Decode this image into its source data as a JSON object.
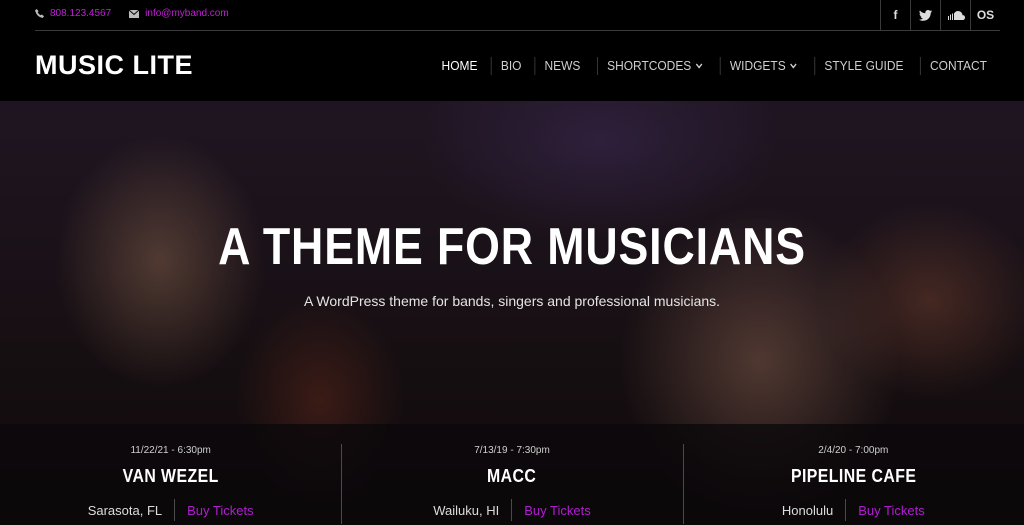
{
  "topbar": {
    "phone": "808.123.4567",
    "email": "info@myband.com",
    "social": [
      {
        "icon": "facebook-icon",
        "glyph": "f"
      },
      {
        "icon": "twitter-icon",
        "glyph": "t"
      },
      {
        "icon": "soundcloud-icon",
        "glyph": ""
      },
      {
        "icon": "lastfm-icon",
        "glyph": "OS"
      }
    ]
  },
  "header": {
    "logo": "MUSIC LITE",
    "nav": [
      {
        "label": "HOME",
        "dropdown": false
      },
      {
        "label": "BIO",
        "dropdown": false
      },
      {
        "label": "NEWS",
        "dropdown": false
      },
      {
        "label": "SHORTCODES",
        "dropdown": true
      },
      {
        "label": "WIDGETS",
        "dropdown": true
      },
      {
        "label": "STYLE GUIDE",
        "dropdown": false
      },
      {
        "label": "CONTACT",
        "dropdown": false
      }
    ]
  },
  "hero": {
    "title": "A THEME FOR MUSICIANS",
    "subtitle": "A WordPress theme for bands, singers and professional musicians."
  },
  "events": [
    {
      "date": "11/22/21 - 6:30pm",
      "venue": "VAN WEZEL",
      "location": "Sarasota, FL",
      "buy": "Buy Tickets"
    },
    {
      "date": "7/13/19 - 7:30pm",
      "venue": "MACC",
      "location": "Wailuku, HI",
      "buy": "Buy Tickets"
    },
    {
      "date": "2/4/20 - 7:00pm",
      "venue": "PIPELINE CAFE",
      "location": "Honolulu",
      "buy": "Buy Tickets"
    }
  ],
  "colors": {
    "accent": "#c21fd6",
    "background": "#000000"
  }
}
